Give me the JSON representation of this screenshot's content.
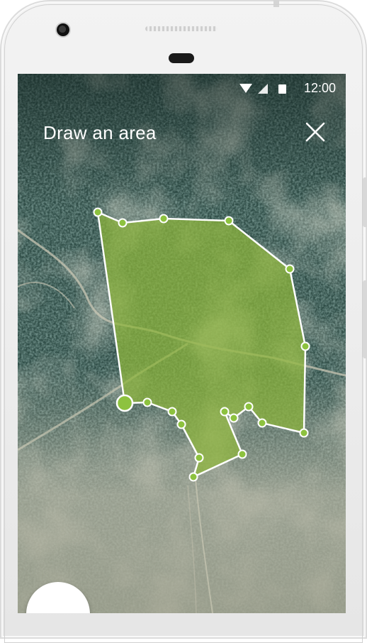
{
  "status_bar": {
    "time": "12:00",
    "icons": [
      "wifi-icon",
      "cell-signal-icon",
      "battery-icon"
    ]
  },
  "header": {
    "title": "Draw an area",
    "close_icon": "close-icon"
  },
  "map": {
    "type": "satellite",
    "drawn_area_color": "#8db53a",
    "vertex_color": "#8dc23f",
    "vertex_count": 21
  },
  "fab": {
    "icon": ""
  },
  "colors": {
    "status_text": "#ffffff",
    "title_text": "#ffffff",
    "polygon_fill": "#8db53a",
    "polygon_stroke": "#ffffff"
  }
}
